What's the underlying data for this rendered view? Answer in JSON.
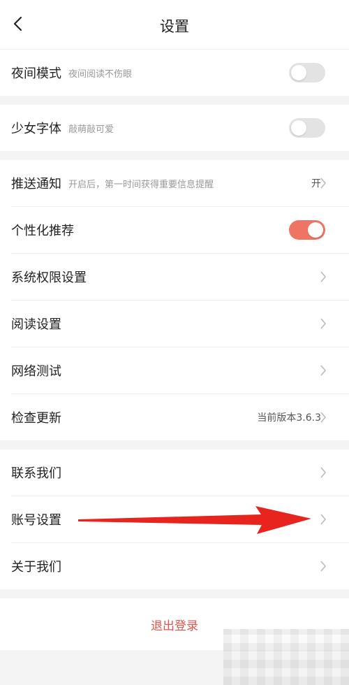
{
  "header": {
    "title": "设置"
  },
  "group1": {
    "night_mode": {
      "label": "夜间模式",
      "sub": "夜间阅读不伤眼",
      "toggle": false
    }
  },
  "group2": {
    "girl_font": {
      "label": "少女字体",
      "sub": "敲萌敲可爱",
      "toggle": false
    }
  },
  "group3": {
    "push": {
      "label": "推送通知",
      "sub": "开启后，第一时间获得重要信息提醒",
      "value": "开"
    },
    "personal": {
      "label": "个性化推荐",
      "toggle": true
    },
    "permissions": {
      "label": "系统权限设置"
    },
    "reading": {
      "label": "阅读设置"
    },
    "network": {
      "label": "网络测试"
    },
    "update": {
      "label": "检查更新",
      "value": "当前版本3.6.3"
    }
  },
  "group4": {
    "contact": {
      "label": "联系我们"
    },
    "account": {
      "label": "账号设置"
    },
    "about": {
      "label": "关于我们"
    }
  },
  "logout": {
    "label": "退出登录"
  },
  "colors": {
    "accent": "#ee7563",
    "logout": "#e0544c",
    "arrow": "#e8241f"
  }
}
